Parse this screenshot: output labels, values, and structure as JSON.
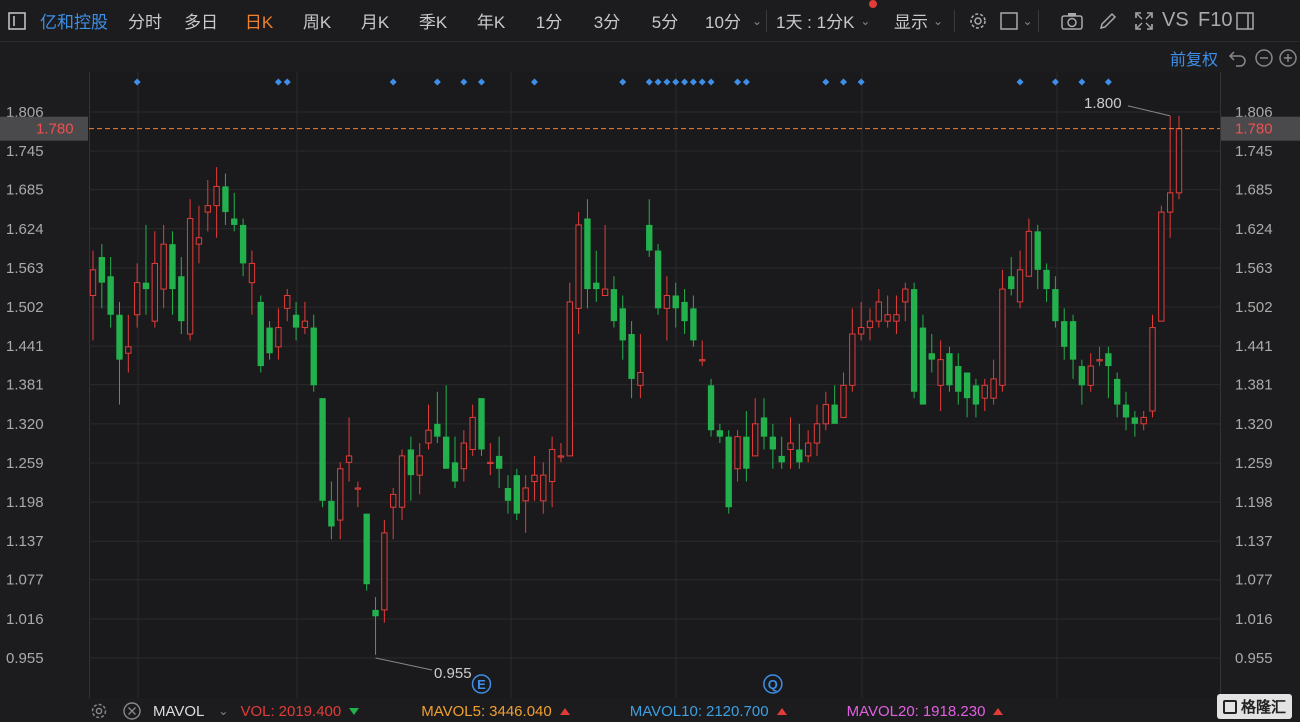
{
  "toolbar": {
    "stock_name": "亿和控股",
    "periods": [
      "分时",
      "多日",
      "日K",
      "周K",
      "月K",
      "季K",
      "年K",
      "1分",
      "3分",
      "5分",
      "10分"
    ],
    "selected_period": "日K",
    "interval_label": "1天 : 1分K",
    "display_label": "显示",
    "vs_label": "VS",
    "f10_label": "F10"
  },
  "subbar": {
    "adjust_label": "前复权"
  },
  "colors": {
    "up": "#e23c39",
    "down": "#22b14c",
    "accent": "#3e8fe9",
    "price_line": "#f08130",
    "bg": "#1c1c1e"
  },
  "chart_data": {
    "type": "candlestick",
    "y_ticks": [
      "1.806",
      "1.745",
      "1.685",
      "1.624",
      "1.563",
      "1.502",
      "1.441",
      "1.381",
      "1.320",
      "1.259",
      "1.198",
      "1.137",
      "1.077",
      "1.016",
      "0.955"
    ],
    "ylim": [
      0.955,
      1.806
    ],
    "current_price": "1.780",
    "max_label": "1.800",
    "min_label": "0.955",
    "max_value": 1.8,
    "min_value": 0.955,
    "event_markers": [
      "E",
      "Q"
    ],
    "event_marker_candles": [
      44,
      77
    ],
    "news_marker_candles": [
      5,
      21,
      22,
      34,
      39,
      42,
      44,
      50,
      60,
      63,
      64,
      65,
      66,
      67,
      68,
      69,
      70,
      73,
      74,
      83,
      85,
      87,
      105,
      109,
      112,
      115
    ],
    "candles": [
      {
        "o": 1.52,
        "c": 1.56,
        "h": 1.59,
        "l": 1.45
      },
      {
        "o": 1.58,
        "c": 1.54,
        "h": 1.6,
        "l": 1.5
      },
      {
        "o": 1.55,
        "c": 1.49,
        "h": 1.58,
        "l": 1.47
      },
      {
        "o": 1.49,
        "c": 1.42,
        "h": 1.51,
        "l": 1.35
      },
      {
        "o": 1.43,
        "c": 1.44,
        "h": 1.49,
        "l": 1.4
      },
      {
        "o": 1.49,
        "c": 1.54,
        "h": 1.57,
        "l": 1.47
      },
      {
        "o": 1.54,
        "c": 1.53,
        "h": 1.63,
        "l": 1.49
      },
      {
        "o": 1.48,
        "c": 1.57,
        "h": 1.62,
        "l": 1.47
      },
      {
        "o": 1.53,
        "c": 1.6,
        "h": 1.63,
        "l": 1.5
      },
      {
        "o": 1.6,
        "c": 1.53,
        "h": 1.62,
        "l": 1.49
      },
      {
        "o": 1.55,
        "c": 1.48,
        "h": 1.58,
        "l": 1.46
      },
      {
        "o": 1.46,
        "c": 1.64,
        "h": 1.67,
        "l": 1.45
      },
      {
        "o": 1.6,
        "c": 1.61,
        "h": 1.66,
        "l": 1.57
      },
      {
        "o": 1.65,
        "c": 1.66,
        "h": 1.7,
        "l": 1.62
      },
      {
        "o": 1.66,
        "c": 1.69,
        "h": 1.72,
        "l": 1.61
      },
      {
        "o": 1.69,
        "c": 1.65,
        "h": 1.71,
        "l": 1.63
      },
      {
        "o": 1.64,
        "c": 1.63,
        "h": 1.68,
        "l": 1.62
      },
      {
        "o": 1.63,
        "c": 1.57,
        "h": 1.64,
        "l": 1.55
      },
      {
        "o": 1.54,
        "c": 1.57,
        "h": 1.59,
        "l": 1.49
      },
      {
        "o": 1.51,
        "c": 1.41,
        "h": 1.52,
        "l": 1.4
      },
      {
        "o": 1.47,
        "c": 1.43,
        "h": 1.48,
        "l": 1.42
      },
      {
        "o": 1.44,
        "c": 1.47,
        "h": 1.5,
        "l": 1.42
      },
      {
        "o": 1.5,
        "c": 1.52,
        "h": 1.53,
        "l": 1.48
      },
      {
        "o": 1.49,
        "c": 1.47,
        "h": 1.51,
        "l": 1.45
      },
      {
        "o": 1.47,
        "c": 1.48,
        "h": 1.51,
        "l": 1.46
      },
      {
        "o": 1.47,
        "c": 1.38,
        "h": 1.49,
        "l": 1.37
      },
      {
        "o": 1.36,
        "c": 1.2,
        "h": 1.36,
        "l": 1.19
      },
      {
        "o": 1.2,
        "c": 1.16,
        "h": 1.23,
        "l": 1.14
      },
      {
        "o": 1.17,
        "c": 1.25,
        "h": 1.26,
        "l": 1.14
      },
      {
        "o": 1.26,
        "c": 1.27,
        "h": 1.33,
        "l": 1.23
      },
      {
        "o": 1.22,
        "c": 1.22,
        "h": 1.23,
        "l": 1.19
      },
      {
        "o": 1.18,
        "c": 1.07,
        "h": 1.18,
        "l": 1.06
      },
      {
        "o": 1.03,
        "c": 1.02,
        "h": 1.05,
        "l": 0.96
      },
      {
        "o": 1.03,
        "c": 1.15,
        "h": 1.17,
        "l": 1.01
      },
      {
        "o": 1.19,
        "c": 1.21,
        "h": 1.22,
        "l": 1.14
      },
      {
        "o": 1.19,
        "c": 1.27,
        "h": 1.28,
        "l": 1.17
      },
      {
        "o": 1.28,
        "c": 1.24,
        "h": 1.3,
        "l": 1.2
      },
      {
        "o": 1.24,
        "c": 1.27,
        "h": 1.29,
        "l": 1.21
      },
      {
        "o": 1.29,
        "c": 1.31,
        "h": 1.35,
        "l": 1.28
      },
      {
        "o": 1.32,
        "c": 1.3,
        "h": 1.37,
        "l": 1.29
      },
      {
        "o": 1.3,
        "c": 1.25,
        "h": 1.38,
        "l": 1.25
      },
      {
        "o": 1.26,
        "c": 1.23,
        "h": 1.3,
        "l": 1.22
      },
      {
        "o": 1.25,
        "c": 1.29,
        "h": 1.31,
        "l": 1.23
      },
      {
        "o": 1.28,
        "c": 1.33,
        "h": 1.35,
        "l": 1.27
      },
      {
        "o": 1.36,
        "c": 1.28,
        "h": 1.36,
        "l": 1.27
      },
      {
        "o": 1.26,
        "c": 1.26,
        "h": 1.29,
        "l": 1.24
      },
      {
        "o": 1.27,
        "c": 1.25,
        "h": 1.3,
        "l": 1.22
      },
      {
        "o": 1.22,
        "c": 1.2,
        "h": 1.24,
        "l": 1.18
      },
      {
        "o": 1.24,
        "c": 1.18,
        "h": 1.25,
        "l": 1.17
      },
      {
        "o": 1.2,
        "c": 1.22,
        "h": 1.24,
        "l": 1.15
      },
      {
        "o": 1.23,
        "c": 1.24,
        "h": 1.27,
        "l": 1.2
      },
      {
        "o": 1.2,
        "c": 1.24,
        "h": 1.26,
        "l": 1.18
      },
      {
        "o": 1.23,
        "c": 1.28,
        "h": 1.3,
        "l": 1.19
      },
      {
        "o": 1.27,
        "c": 1.27,
        "h": 1.29,
        "l": 1.26
      },
      {
        "o": 1.27,
        "c": 1.51,
        "h": 1.54,
        "l": 1.27
      },
      {
        "o": 1.5,
        "c": 1.63,
        "h": 1.65,
        "l": 1.46
      },
      {
        "o": 1.64,
        "c": 1.53,
        "h": 1.67,
        "l": 1.5
      },
      {
        "o": 1.54,
        "c": 1.53,
        "h": 1.59,
        "l": 1.51
      },
      {
        "o": 1.52,
        "c": 1.53,
        "h": 1.63,
        "l": 1.52
      },
      {
        "o": 1.53,
        "c": 1.48,
        "h": 1.55,
        "l": 1.47
      },
      {
        "o": 1.5,
        "c": 1.45,
        "h": 1.52,
        "l": 1.42
      },
      {
        "o": 1.46,
        "c": 1.39,
        "h": 1.48,
        "l": 1.36
      },
      {
        "o": 1.38,
        "c": 1.4,
        "h": 1.46,
        "l": 1.36
      },
      {
        "o": 1.63,
        "c": 1.59,
        "h": 1.67,
        "l": 1.58
      },
      {
        "o": 1.59,
        "c": 1.5,
        "h": 1.6,
        "l": 1.49
      },
      {
        "o": 1.5,
        "c": 1.52,
        "h": 1.55,
        "l": 1.45
      },
      {
        "o": 1.52,
        "c": 1.5,
        "h": 1.54,
        "l": 1.47
      },
      {
        "o": 1.51,
        "c": 1.48,
        "h": 1.53,
        "l": 1.46
      },
      {
        "o": 1.5,
        "c": 1.45,
        "h": 1.52,
        "l": 1.44
      },
      {
        "o": 1.42,
        "c": 1.42,
        "h": 1.45,
        "l": 1.41
      },
      {
        "o": 1.38,
        "c": 1.31,
        "h": 1.39,
        "l": 1.3
      },
      {
        "o": 1.31,
        "c": 1.3,
        "h": 1.32,
        "l": 1.29
      },
      {
        "o": 1.3,
        "c": 1.19,
        "h": 1.31,
        "l": 1.18
      },
      {
        "o": 1.25,
        "c": 1.3,
        "h": 1.31,
        "l": 1.23
      },
      {
        "o": 1.3,
        "c": 1.25,
        "h": 1.34,
        "l": 1.23
      },
      {
        "o": 1.27,
        "c": 1.32,
        "h": 1.36,
        "l": 1.27
      },
      {
        "o": 1.33,
        "c": 1.3,
        "h": 1.36,
        "l": 1.28
      },
      {
        "o": 1.3,
        "c": 1.28,
        "h": 1.32,
        "l": 1.25
      },
      {
        "o": 1.27,
        "c": 1.26,
        "h": 1.3,
        "l": 1.25
      },
      {
        "o": 1.28,
        "c": 1.29,
        "h": 1.33,
        "l": 1.25
      },
      {
        "o": 1.28,
        "c": 1.26,
        "h": 1.32,
        "l": 1.25
      },
      {
        "o": 1.27,
        "c": 1.29,
        "h": 1.31,
        "l": 1.26
      },
      {
        "o": 1.29,
        "c": 1.32,
        "h": 1.35,
        "l": 1.27
      },
      {
        "o": 1.32,
        "c": 1.35,
        "h": 1.37,
        "l": 1.31
      },
      {
        "o": 1.35,
        "c": 1.32,
        "h": 1.38,
        "l": 1.32
      },
      {
        "o": 1.33,
        "c": 1.38,
        "h": 1.4,
        "l": 1.33
      },
      {
        "o": 1.38,
        "c": 1.46,
        "h": 1.5,
        "l": 1.37
      },
      {
        "o": 1.46,
        "c": 1.47,
        "h": 1.51,
        "l": 1.45
      },
      {
        "o": 1.47,
        "c": 1.48,
        "h": 1.5,
        "l": 1.45
      },
      {
        "o": 1.48,
        "c": 1.51,
        "h": 1.53,
        "l": 1.47
      },
      {
        "o": 1.48,
        "c": 1.49,
        "h": 1.52,
        "l": 1.47
      },
      {
        "o": 1.48,
        "c": 1.49,
        "h": 1.52,
        "l": 1.46
      },
      {
        "o": 1.51,
        "c": 1.53,
        "h": 1.54,
        "l": 1.48
      },
      {
        "o": 1.53,
        "c": 1.37,
        "h": 1.54,
        "l": 1.36
      },
      {
        "o": 1.47,
        "c": 1.35,
        "h": 1.49,
        "l": 1.35
      },
      {
        "o": 1.43,
        "c": 1.42,
        "h": 1.46,
        "l": 1.4
      },
      {
        "o": 1.38,
        "c": 1.42,
        "h": 1.45,
        "l": 1.34
      },
      {
        "o": 1.43,
        "c": 1.38,
        "h": 1.44,
        "l": 1.37
      },
      {
        "o": 1.41,
        "c": 1.37,
        "h": 1.43,
        "l": 1.35
      },
      {
        "o": 1.4,
        "c": 1.36,
        "h": 1.4,
        "l": 1.33
      },
      {
        "o": 1.38,
        "c": 1.35,
        "h": 1.39,
        "l": 1.33
      },
      {
        "o": 1.36,
        "c": 1.38,
        "h": 1.39,
        "l": 1.34
      },
      {
        "o": 1.36,
        "c": 1.39,
        "h": 1.42,
        "l": 1.35
      },
      {
        "o": 1.38,
        "c": 1.53,
        "h": 1.56,
        "l": 1.37
      },
      {
        "o": 1.55,
        "c": 1.53,
        "h": 1.58,
        "l": 1.52
      },
      {
        "o": 1.51,
        "c": 1.56,
        "h": 1.59,
        "l": 1.5
      },
      {
        "o": 1.55,
        "c": 1.62,
        "h": 1.64,
        "l": 1.55
      },
      {
        "o": 1.62,
        "c": 1.56,
        "h": 1.63,
        "l": 1.53
      },
      {
        "o": 1.56,
        "c": 1.53,
        "h": 1.57,
        "l": 1.51
      },
      {
        "o": 1.53,
        "c": 1.48,
        "h": 1.55,
        "l": 1.47
      },
      {
        "o": 1.48,
        "c": 1.44,
        "h": 1.5,
        "l": 1.42
      },
      {
        "o": 1.48,
        "c": 1.42,
        "h": 1.49,
        "l": 1.39
      },
      {
        "o": 1.41,
        "c": 1.38,
        "h": 1.42,
        "l": 1.35
      },
      {
        "o": 1.38,
        "c": 1.41,
        "h": 1.43,
        "l": 1.37
      },
      {
        "o": 1.42,
        "c": 1.42,
        "h": 1.44,
        "l": 1.41
      },
      {
        "o": 1.43,
        "c": 1.41,
        "h": 1.44,
        "l": 1.36
      },
      {
        "o": 1.39,
        "c": 1.35,
        "h": 1.4,
        "l": 1.33
      },
      {
        "o": 1.35,
        "c": 1.33,
        "h": 1.37,
        "l": 1.31
      },
      {
        "o": 1.33,
        "c": 1.32,
        "h": 1.34,
        "l": 1.3
      },
      {
        "o": 1.32,
        "c": 1.33,
        "h": 1.34,
        "l": 1.31
      },
      {
        "o": 1.34,
        "c": 1.47,
        "h": 1.49,
        "l": 1.33
      },
      {
        "o": 1.48,
        "c": 1.65,
        "h": 1.66,
        "l": 1.48
      },
      {
        "o": 1.65,
        "c": 1.68,
        "h": 1.8,
        "l": 1.61
      },
      {
        "o": 1.68,
        "c": 1.78,
        "h": 1.8,
        "l": 1.67
      }
    ]
  },
  "mavol": {
    "name": "MAVOL",
    "vol_label": "VOL:",
    "vol_value": "2019.400",
    "vol_dir": "down",
    "ma5_label": "MAVOL5:",
    "ma5_value": "3446.040",
    "ma5_dir": "up",
    "ma10_label": "MAVOL10:",
    "ma10_value": "2120.700",
    "ma10_dir": "up",
    "ma20_label": "MAVOL20:",
    "ma20_value": "1918.230",
    "ma20_dir": "up"
  },
  "brand": {
    "logo_text": "格隆汇"
  }
}
